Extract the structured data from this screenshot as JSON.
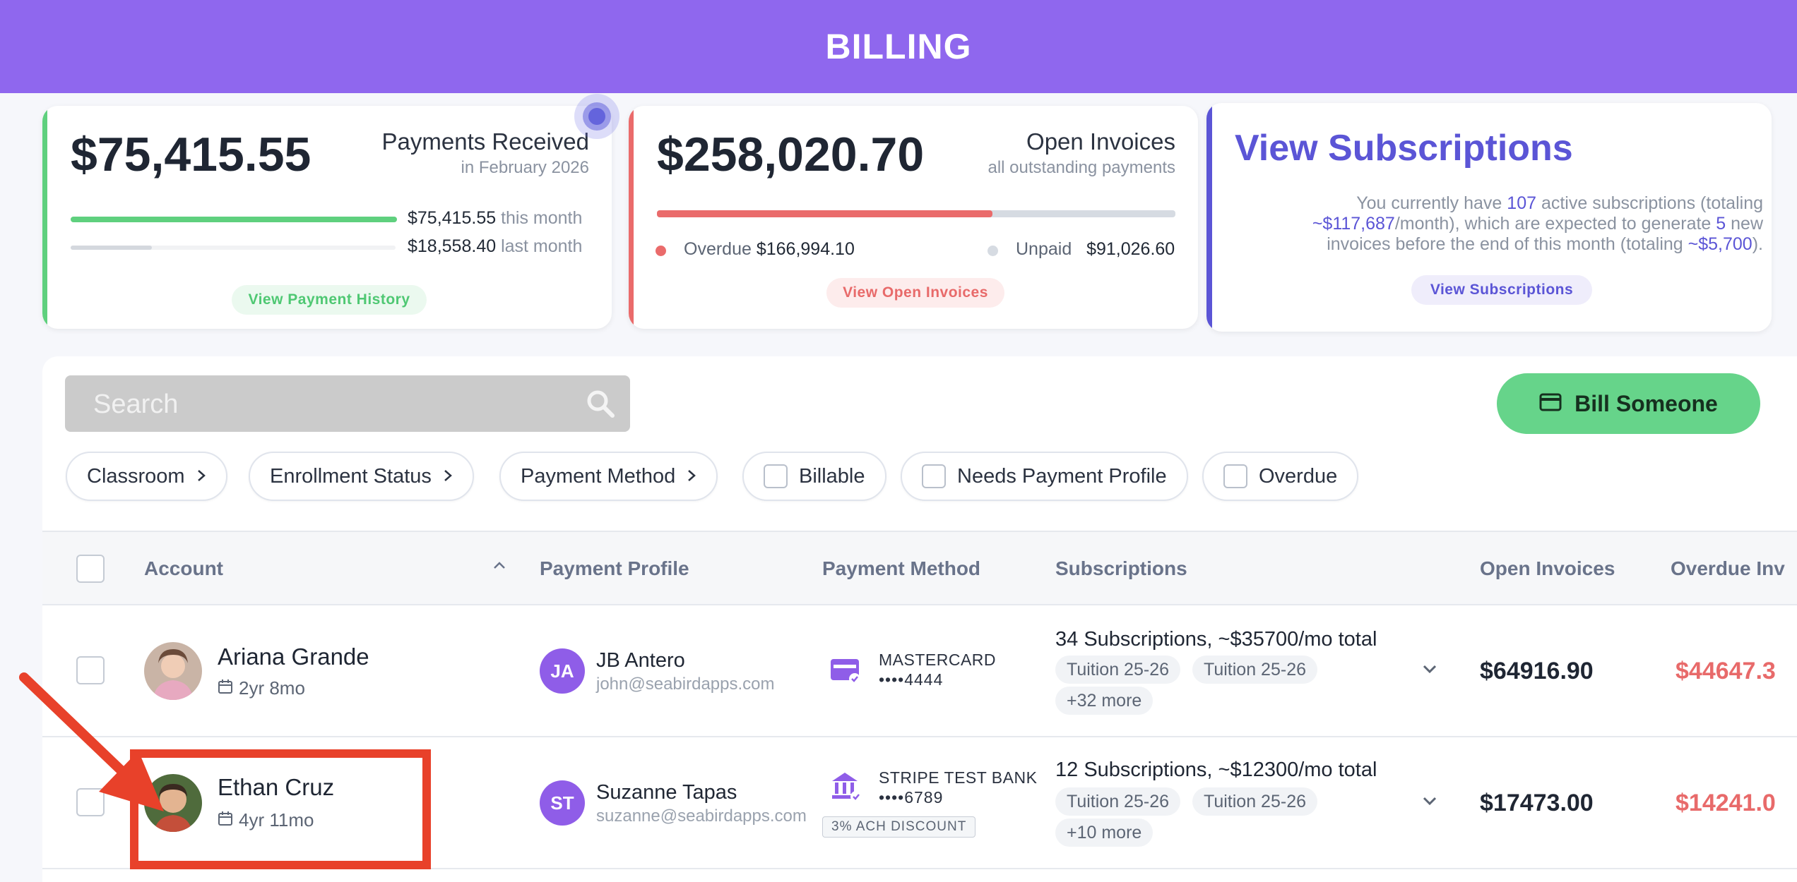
{
  "header": {
    "title": "BILLING"
  },
  "cards": {
    "payments": {
      "amount": "$75,415.55",
      "title": "Payments Received",
      "subtitle": "in February 2026",
      "this_month_amount": "$75,415.55",
      "this_month_label": "this month",
      "last_month_amount": "$18,558.40",
      "last_month_label": "last month",
      "this_month_fraction": 1.0,
      "last_month_fraction": 0.25,
      "button": "View Payment History",
      "accent": "#5fd07e"
    },
    "invoices": {
      "amount": "$258,020.70",
      "title": "Open Invoices",
      "subtitle": "all outstanding payments",
      "overdue_label": "Overdue",
      "overdue_amount": "$166,994.10",
      "unpaid_label": "Unpaid",
      "unpaid_amount": "$91,026.60",
      "overdue_fraction": 0.647,
      "button": "View Open Invoices",
      "accent": "#ea6b6b"
    },
    "subscriptions": {
      "title": "View Subscriptions",
      "t1": "You currently have ",
      "count": "107",
      "t2": " active subscriptions (totaling",
      "monthly_total": "~$117,687",
      "t3": "/month), which are expected to generate ",
      "new_count": "5",
      "t4": " new",
      "t5": "invoices before the end of this month (totaling ",
      "expected": "~$5,700",
      "t6": ").",
      "button": "View Subscriptions",
      "accent": "#5b55d6"
    }
  },
  "search": {
    "placeholder": "Search"
  },
  "bill_button": "Bill Someone",
  "filters": {
    "classroom": "Classroom",
    "enrollment": "Enrollment Status",
    "payment_method": "Payment Method",
    "billable": "Billable",
    "needs_profile": "Needs Payment Profile",
    "overdue": "Overdue"
  },
  "table": {
    "headers": {
      "account": "Account",
      "payment_profile": "Payment Profile",
      "payment_method": "Payment Method",
      "subscriptions": "Subscriptions",
      "open_invoices": "Open Invoices",
      "overdue_invoices": "Overdue Inv"
    },
    "rows": [
      {
        "name": "Ariana Grande",
        "age": "2yr 8mo",
        "pp_initials": "JA",
        "pp_name": "JB Antero",
        "pp_email": "john@seabirdapps.com",
        "pm_label": "MASTERCARD",
        "pm_num": "••••4444",
        "sub_title": "34 Subscriptions, ~$35700/mo total",
        "tag1": "Tuition 25-26",
        "tag2": "Tuition 25-26",
        "more": "+32 more",
        "open": "$64916.90",
        "overdue": "$44647.3"
      },
      {
        "name": "Ethan Cruz",
        "age": "4yr 11mo",
        "pp_initials": "ST",
        "pp_name": "Suzanne Tapas",
        "pp_email": "suzanne@seabirdapps.com",
        "pm_label": "STRIPE TEST BANK",
        "pm_num": "••••6789",
        "pm_badge": "3% ACH DISCOUNT",
        "sub_title": "12 Subscriptions, ~$12300/mo total",
        "tag1": "Tuition 25-26",
        "tag2": "Tuition 25-26",
        "more": "+10 more",
        "open": "$17473.00",
        "overdue": "$14241.0"
      }
    ]
  }
}
